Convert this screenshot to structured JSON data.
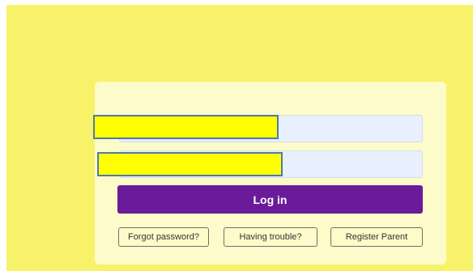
{
  "colors": {
    "page_background": "#f8f26b",
    "card_background": "#fdfbc9",
    "input_background": "#e8f0fe",
    "primary_button": "#6a1b9a",
    "redaction": "#ffff00",
    "redaction_border": "#4f7aa8"
  },
  "login_form": {
    "username_value": "",
    "password_value": "",
    "login_label": "Log in"
  },
  "links": {
    "forgot_password": "Forgot password?",
    "having_trouble": "Having trouble?",
    "register_parent": "Register Parent"
  }
}
